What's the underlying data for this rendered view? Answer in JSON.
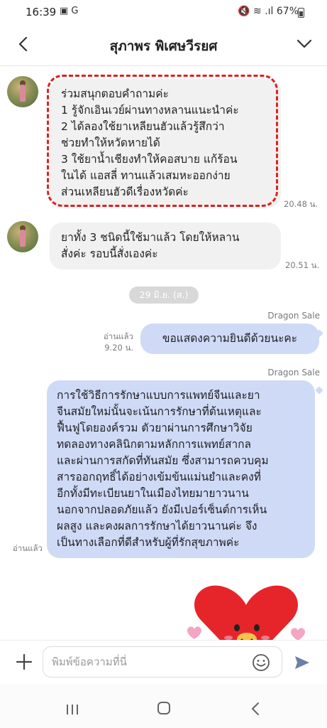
{
  "status_bar": {
    "time": "16:39",
    "left_icons": "▣ G",
    "right_text": "🔇 ≋ .ıl 67%"
  },
  "header": {
    "title": "สุภาพร พิเศษวีรยศ"
  },
  "messages": {
    "m1": {
      "lines": [
        "ร่วมสนุกตอบคำถามค่ะ",
        "1 รู้จักเอินเวย์ผ่านทางหลานแนะนำค่ะ",
        "2 ได้ลองใช้ยาเหลียนฮัวแล้วรู้สึกว่า",
        "ช่วยทำให้หวัดหายได้",
        "3 ใช้ยาน้ำเชียงทำให้คอสบาย แก้ร้อน",
        "ในได้ แอสลี่ ทานแล้วเสมหะออกง่าย",
        "ส่วนเหลียนฮัวดีเรื่องหวัดค่ะ"
      ],
      "time": "20.48 น."
    },
    "m2": {
      "lines": [
        "ยาทั้ง 3 ชนิดนี้ใช้มาแล้ว โดยให้หลาน",
        "สั่งค่ะ รอบนี้สั่งเองค่ะ"
      ],
      "time": "20.51 น."
    },
    "date_chip": "29 มิ.ย. (ส.)",
    "m3": {
      "sender": "Dragon Sale",
      "text": "ขอแสดงความยินดีด้วยนะคะ",
      "read": "อ่านแล้ว",
      "time": "9.20 น."
    },
    "m4": {
      "sender": "Dragon Sale",
      "lines": [
        "การใช้วิธีการรักษาแบบการแพทย์จีนและยา",
        "จีนสมัยใหม่นั้นจะเน้นการรักษาที่ต้นเหตุและ",
        "ฟื้นฟูโดยองค์รวม ตัวยาผ่านการศึกษาวิจัย",
        "ทดลองทางคลินิกตามหลักการแพทย์สากล",
        "และผ่านการสกัดที่ทันสมัย ซึ่งสามารถควบคุม",
        "สารออกฤทธิ์ได้อย่างเข้มข้นแม่นยำและคงที่",
        "อีกทั้งมีทะเบียนยาในเมืองไทยมายาวนาน",
        "นอกจากปลอดภัยแล้ว ยังมีเปอร์เซ็นต์การเห็น",
        "ผลสูง และคงผลการรักษาได้ยาวนานค่ะ จึง",
        "เป็นทางเลือกที่ดีสำหรับผู้ที่รักสุขภาพค่ะ"
      ],
      "read": "อ่านแล้ว"
    }
  },
  "input": {
    "placeholder": "พิมพ์ข้อความที่นี่"
  },
  "icons": {
    "back": "chevron-left-icon",
    "menu": "chevron-down-icon",
    "plus": "plus-icon",
    "emoji": "smiley-icon",
    "send": "send-icon"
  },
  "colors": {
    "incoming_bubble": "#f1f1f1",
    "outgoing_bubble": "#cfdaf7",
    "highlight_border": "#e0201f",
    "sticker_red": "#e6252a"
  }
}
